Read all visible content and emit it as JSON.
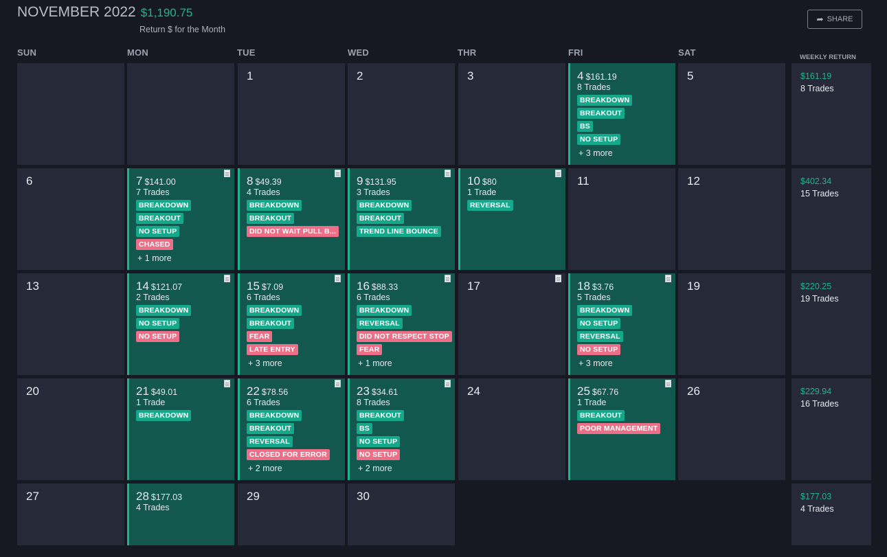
{
  "header": {
    "title": "NOVEMBER 2022",
    "month_return": "$1,190.75",
    "subtitle": "Return $ for the Month",
    "share_label": "SHARE"
  },
  "weekdays": [
    "SUN",
    "MON",
    "TUE",
    "WED",
    "THR",
    "FRI",
    "SAT"
  ],
  "weekly_header": "WEEKLY RETURN",
  "weeks": [
    {
      "days": [
        {
          "day": "",
          "empty": true
        },
        {
          "day": "",
          "empty": true
        },
        {
          "day": "1"
        },
        {
          "day": "2"
        },
        {
          "day": "3"
        },
        {
          "day": "4",
          "amount": "$161.19",
          "trades": "8 Trades",
          "note": false,
          "tags": [
            {
              "label": "BREAKDOWN",
              "kind": "good"
            },
            {
              "label": "BREAKOUT",
              "kind": "good"
            },
            {
              "label": "BS",
              "kind": "good"
            },
            {
              "label": "NO SETUP",
              "kind": "good"
            }
          ],
          "more": "+ 3 more"
        },
        {
          "day": "5"
        }
      ],
      "weekly": {
        "amount": "$161.19",
        "trades": "8 Trades"
      }
    },
    {
      "days": [
        {
          "day": "6"
        },
        {
          "day": "7",
          "amount": "$141.00",
          "trades": "7 Trades",
          "note": true,
          "tags": [
            {
              "label": "BREAKDOWN",
              "kind": "good"
            },
            {
              "label": "BREAKOUT",
              "kind": "good"
            },
            {
              "label": "NO SETUP",
              "kind": "good"
            },
            {
              "label": "CHASED",
              "kind": "bad"
            }
          ],
          "more": "+ 1 more"
        },
        {
          "day": "8",
          "amount": "$49.39",
          "trades": "4 Trades",
          "note": true,
          "tags": [
            {
              "label": "BREAKDOWN",
              "kind": "good"
            },
            {
              "label": "BREAKOUT",
              "kind": "good"
            },
            {
              "label": "DID NOT WAIT PULL B...",
              "kind": "bad"
            }
          ]
        },
        {
          "day": "9",
          "amount": "$131.95",
          "trades": "3 Trades",
          "note": true,
          "tags": [
            {
              "label": "BREAKDOWN",
              "kind": "good"
            },
            {
              "label": "BREAKOUT",
              "kind": "good"
            },
            {
              "label": "TREND LINE BOUNCE",
              "kind": "good"
            }
          ]
        },
        {
          "day": "10",
          "amount": "$80",
          "trades": "1 Trade",
          "note": true,
          "tags": [
            {
              "label": "REVERSAL",
              "kind": "good"
            }
          ]
        },
        {
          "day": "11"
        },
        {
          "day": "12"
        }
      ],
      "weekly": {
        "amount": "$402.34",
        "trades": "15 Trades"
      }
    },
    {
      "days": [
        {
          "day": "13"
        },
        {
          "day": "14",
          "amount": "$121.07",
          "trades": "2 Trades",
          "note": true,
          "tags": [
            {
              "label": "BREAKDOWN",
              "kind": "good"
            },
            {
              "label": "NO SETUP",
              "kind": "good"
            },
            {
              "label": "NO SETUP",
              "kind": "bad"
            }
          ]
        },
        {
          "day": "15",
          "amount": "$7.09",
          "trades": "6 Trades",
          "note": true,
          "tags": [
            {
              "label": "BREAKDOWN",
              "kind": "good"
            },
            {
              "label": "BREAKOUT",
              "kind": "good"
            },
            {
              "label": "FEAR",
              "kind": "bad"
            },
            {
              "label": "LATE ENTRY",
              "kind": "bad"
            }
          ],
          "more": "+ 3 more"
        },
        {
          "day": "16",
          "amount": "$88.33",
          "trades": "6 Trades",
          "note": true,
          "tags": [
            {
              "label": "BREAKDOWN",
              "kind": "good"
            },
            {
              "label": "REVERSAL",
              "kind": "good"
            },
            {
              "label": "DID NOT RESPECT STOP",
              "kind": "bad"
            },
            {
              "label": "FEAR",
              "kind": "bad"
            }
          ],
          "more": "+ 1 more"
        },
        {
          "day": "17",
          "note": true
        },
        {
          "day": "18",
          "amount": "$3.76",
          "trades": "5 Trades",
          "note": true,
          "tags": [
            {
              "label": "BREAKDOWN",
              "kind": "good"
            },
            {
              "label": "NO SETUP",
              "kind": "good"
            },
            {
              "label": "REVERSAL",
              "kind": "good"
            },
            {
              "label": "NO SETUP",
              "kind": "bad"
            }
          ],
          "more": "+ 3 more"
        },
        {
          "day": "19"
        }
      ],
      "weekly": {
        "amount": "$220.25",
        "trades": "19 Trades"
      }
    },
    {
      "days": [
        {
          "day": "20"
        },
        {
          "day": "21",
          "amount": "$49.01",
          "trades": "1 Trade",
          "note": true,
          "tags": [
            {
              "label": "BREAKDOWN",
              "kind": "good"
            }
          ]
        },
        {
          "day": "22",
          "amount": "$78.56",
          "trades": "6 Trades",
          "note": true,
          "tags": [
            {
              "label": "BREAKDOWN",
              "kind": "good"
            },
            {
              "label": "BREAKOUT",
              "kind": "good"
            },
            {
              "label": "REVERSAL",
              "kind": "good"
            },
            {
              "label": "CLOSED FOR ERROR",
              "kind": "bad"
            }
          ],
          "more": "+ 2 more"
        },
        {
          "day": "23",
          "amount": "$34.61",
          "trades": "8 Trades",
          "note": true,
          "tags": [
            {
              "label": "BREAKOUT",
              "kind": "good"
            },
            {
              "label": "BS",
              "kind": "good"
            },
            {
              "label": "NO SETUP",
              "kind": "good"
            },
            {
              "label": "NO SETUP",
              "kind": "bad"
            }
          ],
          "more": "+ 2 more"
        },
        {
          "day": "24"
        },
        {
          "day": "25",
          "amount": "$67.76",
          "trades": "1 Trade",
          "note": true,
          "tags": [
            {
              "label": "BREAKOUT",
              "kind": "good"
            },
            {
              "label": "POOR MANAGEMENT",
              "kind": "bad"
            }
          ]
        },
        {
          "day": "26"
        }
      ],
      "weekly": {
        "amount": "$229.94",
        "trades": "16 Trades"
      }
    },
    {
      "days": [
        {
          "day": "27"
        },
        {
          "day": "28",
          "amount": "$177.03",
          "trades": "4 Trades"
        },
        {
          "day": "29"
        },
        {
          "day": "30"
        },
        {
          "day": "",
          "hidden": true
        },
        {
          "day": "",
          "hidden": true
        },
        {
          "day": "",
          "hidden": true
        }
      ],
      "weekly": {
        "amount": "$177.03",
        "trades": "4 Trades"
      }
    }
  ],
  "colors": {
    "background": "#171922",
    "cell": "#262938",
    "trade_cell": "#12584f",
    "trade_border": "#1eb38c",
    "positive": "#1fb58b",
    "tag_good": "#16a88a",
    "tag_bad": "#ed6e87"
  },
  "icons": {
    "share": "share-arrow-icon",
    "note": "note-icon"
  }
}
